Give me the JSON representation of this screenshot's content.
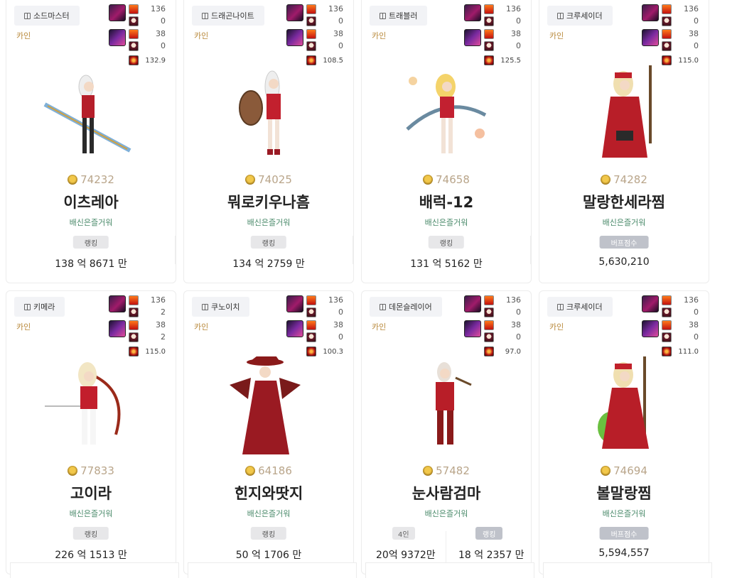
{
  "cards": [
    {
      "class": "소드마스터",
      "server": "카인",
      "eq1": [
        "136",
        "0"
      ],
      "eq2": [
        "38",
        "0"
      ],
      "score": "132.9",
      "power": "74232",
      "name": "이츠레아",
      "guild": "배신은즐거워",
      "tag": "랭킹",
      "tag_type": "rank",
      "amount": "138 억 8671 만"
    },
    {
      "class": "드래곤나이트",
      "server": "카인",
      "eq1": [
        "136",
        "0"
      ],
      "eq2": [
        "38",
        "0"
      ],
      "score": "108.5",
      "power": "74025",
      "name": "뭐로키우나흠",
      "guild": "배신은즐거워",
      "tag": "랭킹",
      "tag_type": "rank",
      "amount": "134 억 2759 만"
    },
    {
      "class": "트래블러",
      "server": "카인",
      "eq1": [
        "136",
        "0"
      ],
      "eq2": [
        "38",
        "0"
      ],
      "score": "125.5",
      "power": "74658",
      "name": "배럭-12",
      "guild": "배신은즐거워",
      "tag": "랭킹",
      "tag_type": "rank",
      "amount": "131 억 5162 만"
    },
    {
      "class": "크루세이더",
      "server": "카인",
      "eq1": [
        "136",
        "0"
      ],
      "eq2": [
        "38",
        "0"
      ],
      "score": "115.0",
      "power": "74282",
      "name": "말랑한세라찜",
      "guild": "배신은즐거워",
      "tag": "버프점수",
      "tag_type": "buff",
      "amount": "5,630,210"
    },
    {
      "class": "키메라",
      "server": "카인",
      "eq1": [
        "136",
        "2"
      ],
      "eq2": [
        "38",
        "2"
      ],
      "score": "115.0",
      "power": "77833",
      "name": "고이라",
      "guild": "배신은즐거워",
      "tag": "랭킹",
      "tag_type": "rank",
      "amount": "226 억 1513 만"
    },
    {
      "class": "쿠노이치",
      "server": "카인",
      "eq1": [
        "136",
        "0"
      ],
      "eq2": [
        "38",
        "0"
      ],
      "score": "100.3",
      "power": "64186",
      "name": "힌지와땃지",
      "guild": "배신은즐거워",
      "tag": "랭킹",
      "tag_type": "rank",
      "amount": "50 억 1706 만"
    },
    {
      "class": "데몬슬레이어",
      "server": "카인",
      "eq1": [
        "136",
        "0"
      ],
      "eq2": [
        "38",
        "0"
      ],
      "score": "97.0",
      "power": "57482",
      "name": "눈사람검마",
      "guild": "배신은즐거워",
      "tag_left": "4인",
      "tag": "랭킹",
      "tag_type": "split",
      "amount_left": "20억 9372만",
      "amount": "18 억 2357 만"
    },
    {
      "class": "크루세이더",
      "server": "카인",
      "eq1": [
        "136",
        "0"
      ],
      "eq2": [
        "38",
        "0"
      ],
      "score": "111.0",
      "power": "74694",
      "name": "볼말랑찜",
      "guild": "배신은즐거워",
      "tag": "버프점수",
      "tag_type": "buff",
      "amount": "5,594,557"
    }
  ],
  "colors": {
    "server": "#b8883a",
    "guild": "#4a8a6a",
    "power": "#b9a58a"
  }
}
